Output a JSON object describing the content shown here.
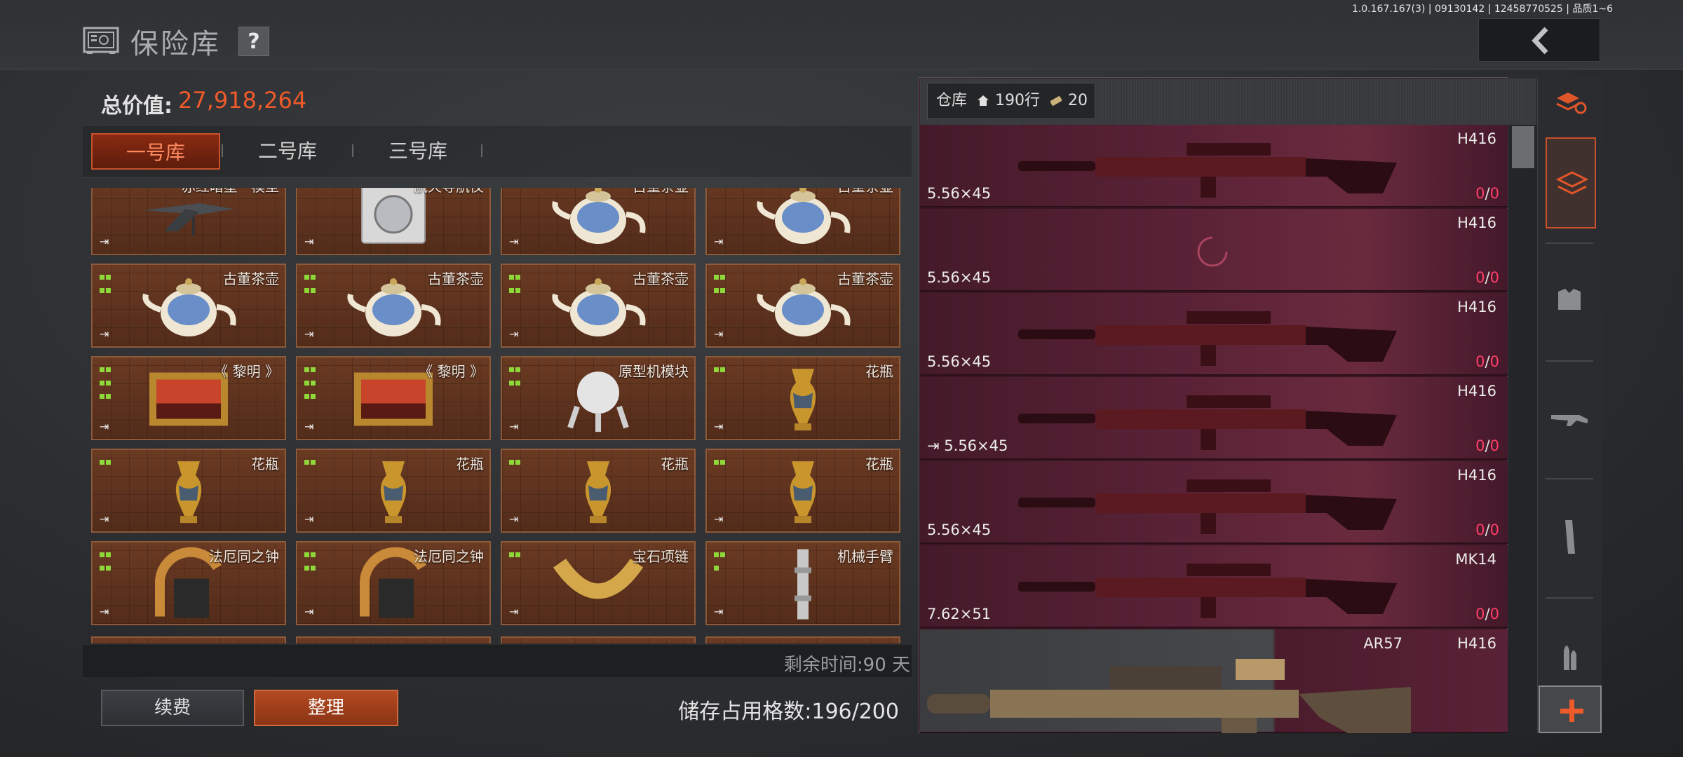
{
  "build_info": "1.0.167.167(3) | 09130142 | 12458770525 | 品质1~6",
  "header": {
    "title": "保险库",
    "help_label": "?"
  },
  "summary": {
    "total_label": "总价值:",
    "total_value": "27,918,264"
  },
  "tabs": [
    {
      "label": "一号库",
      "active": true
    },
    {
      "label": "二号库",
      "active": false
    },
    {
      "label": "三号库",
      "active": false
    }
  ],
  "items": [
    {
      "name": "赤红暗星 · 模型",
      "icon": "jet-model-icon",
      "dots": 2
    },
    {
      "name": "航天导航仪",
      "icon": "navigator-device-icon",
      "dots": 2
    },
    {
      "name": "古董茶壶",
      "icon": "teapot-icon",
      "dots": 2
    },
    {
      "name": "古董茶壶",
      "icon": "teapot-icon",
      "dots": 2
    },
    {
      "name": "古董茶壶",
      "icon": "teapot-icon",
      "dots": 4
    },
    {
      "name": "古董茶壶",
      "icon": "teapot-icon",
      "dots": 4
    },
    {
      "name": "古董茶壶",
      "icon": "teapot-icon",
      "dots": 4
    },
    {
      "name": "古董茶壶",
      "icon": "teapot-icon",
      "dots": 4
    },
    {
      "name": "《 黎明 》",
      "icon": "painting-icon",
      "dots": 6
    },
    {
      "name": "《 黎明 》",
      "icon": "painting-icon",
      "dots": 6
    },
    {
      "name": "原型机模块",
      "icon": "prototype-module-icon",
      "dots": 4
    },
    {
      "name": "花瓶",
      "icon": "vase-icon",
      "dots": 2
    },
    {
      "name": "花瓶",
      "icon": "vase-icon",
      "dots": 2
    },
    {
      "name": "花瓶",
      "icon": "vase-icon",
      "dots": 2
    },
    {
      "name": "花瓶",
      "icon": "vase-icon",
      "dots": 2
    },
    {
      "name": "花瓶",
      "icon": "vase-icon",
      "dots": 2
    },
    {
      "name": "法厄同之钟",
      "icon": "clock-icon",
      "dots": 4
    },
    {
      "name": "法厄同之钟",
      "icon": "clock-icon",
      "dots": 4
    },
    {
      "name": "宝石项链",
      "icon": "necklace-icon",
      "dots": 2
    },
    {
      "name": "机械手臂",
      "icon": "mech-arm-icon",
      "dots": 3
    }
  ],
  "footer": {
    "time_label": "剩余时间:90 天",
    "renew_label": "续费",
    "sort_label": "整理",
    "storage_label": "储存占用格数:196/200"
  },
  "warehouse": {
    "chip_label": "仓库",
    "rows_a": "190行",
    "rows_b": "20行"
  },
  "guns": [
    {
      "name": "H416",
      "ammo": "5.56×45",
      "count_cur": "0",
      "count_max": "0",
      "loading": false,
      "exit": false
    },
    {
      "name": "H416",
      "ammo": "5.56×45",
      "count_cur": "0",
      "count_max": "0",
      "loading": true,
      "exit": false
    },
    {
      "name": "H416",
      "ammo": "5.56×45",
      "count_cur": "0",
      "count_max": "0",
      "loading": false,
      "exit": false
    },
    {
      "name": "H416",
      "ammo": "5.56×45",
      "count_cur": "0",
      "count_max": "0",
      "loading": false,
      "exit": true
    },
    {
      "name": "H416",
      "ammo": "5.56×45",
      "count_cur": "0",
      "count_max": "0",
      "loading": false,
      "exit": false
    },
    {
      "name": "MK14",
      "ammo": "7.62×51",
      "count_cur": "0",
      "count_max": "0",
      "loading": false,
      "exit": false
    }
  ],
  "last_row": {
    "name_a": "AR57",
    "name_b": "H416"
  },
  "colors": {
    "accent": "#ef5a2a",
    "count_red": "#ff3e6a",
    "item_dot": "#8fd83a"
  }
}
